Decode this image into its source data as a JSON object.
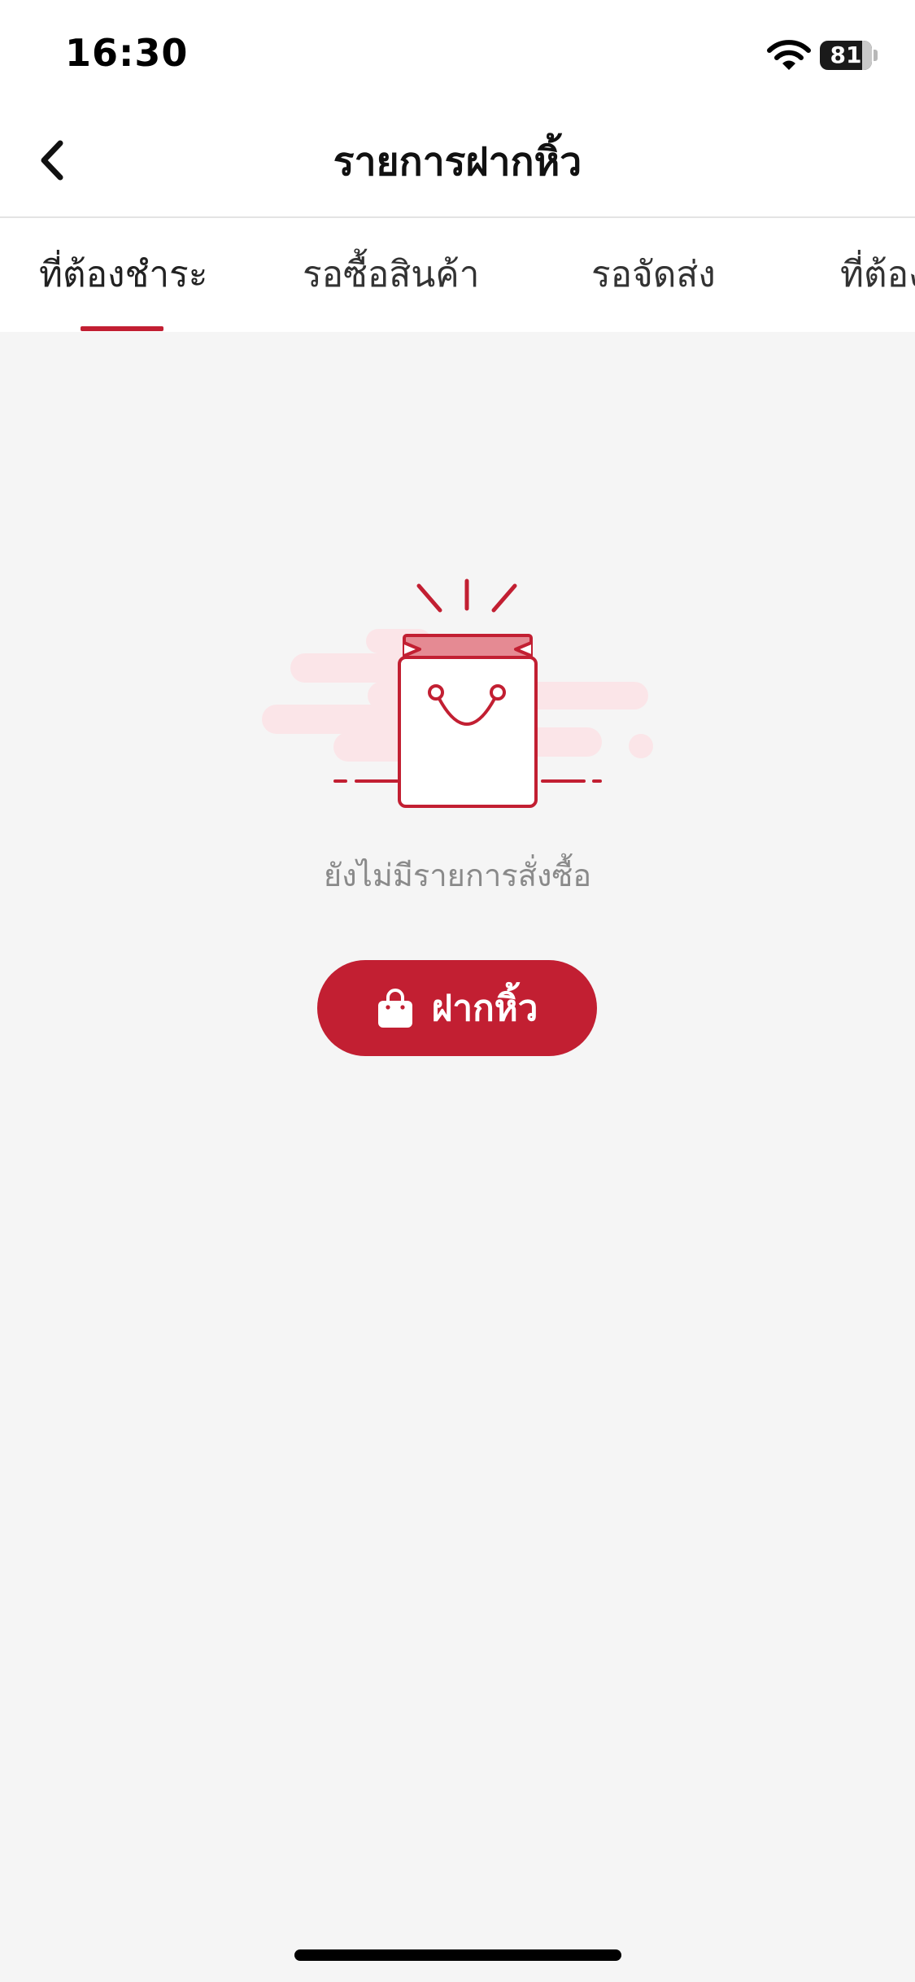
{
  "status_bar": {
    "time": "16:30",
    "battery_level": "81"
  },
  "header": {
    "title": "รายการฝากหิ้ว"
  },
  "tabs": [
    {
      "label": "ที่ต้องชำระ",
      "active": true
    },
    {
      "label": "รอซื้อสินค้า",
      "active": false
    },
    {
      "label": "รอจัดส่ง",
      "active": false
    },
    {
      "label": "ที่ต้อง",
      "active": false
    }
  ],
  "empty_state": {
    "message": "ยังไม่มีรายการสั่งซื้อ",
    "illustration": "shopping-bag-icon",
    "button_label": "ฝากหิ้ว",
    "button_icon": "bag-icon"
  },
  "colors": {
    "accent": "#c21f32",
    "accent_light": "#e58a93",
    "cloud": "#fbe5e8",
    "background": "#f5f5f5",
    "muted_text": "#8a8a8a"
  }
}
